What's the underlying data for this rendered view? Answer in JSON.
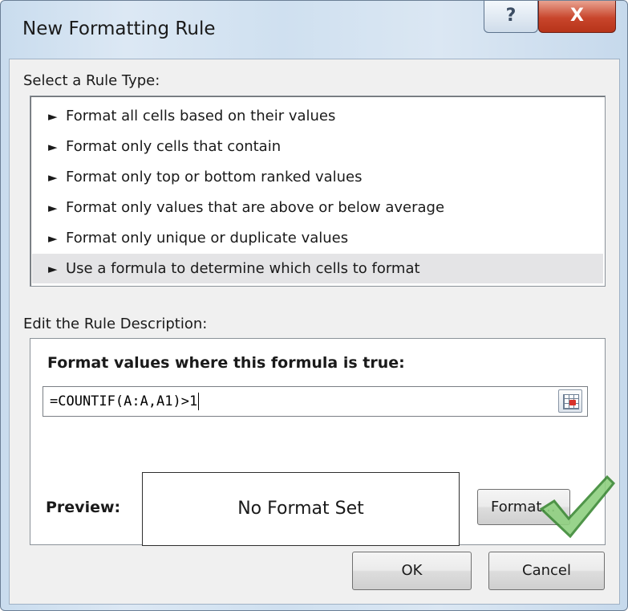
{
  "window": {
    "title": "New Formatting Rule",
    "help_label": "?",
    "close_label": "X"
  },
  "rule_type": {
    "section_label": "Select a Rule Type:",
    "items": [
      {
        "arrow": "►",
        "label": "Format all cells based on their values"
      },
      {
        "arrow": "►",
        "label": "Format only cells that contain"
      },
      {
        "arrow": "►",
        "label": "Format only top or bottom ranked values"
      },
      {
        "arrow": "►",
        "label": "Format only values that are above or below average"
      },
      {
        "arrow": "►",
        "label": "Format only unique or duplicate values"
      },
      {
        "arrow": "►",
        "label": "Use a formula to determine which cells to format"
      }
    ],
    "selected_index": 5
  },
  "description": {
    "section_label": "Edit the Rule Description:",
    "formula_heading": "Format values where this formula is true:",
    "formula_value": "=COUNTIF(A:A,A1)>1",
    "ref_button_icon": "collapse-dialog-icon"
  },
  "preview": {
    "label": "Preview:",
    "text": "No Format Set"
  },
  "buttons": {
    "format_label": "Format...",
    "ok_label": "OK",
    "cancel_label": "Cancel"
  },
  "colors": {
    "close_red": "#c8452c",
    "selected_row": "#e4e4e6",
    "checkmark_green": "#7cc46a"
  }
}
